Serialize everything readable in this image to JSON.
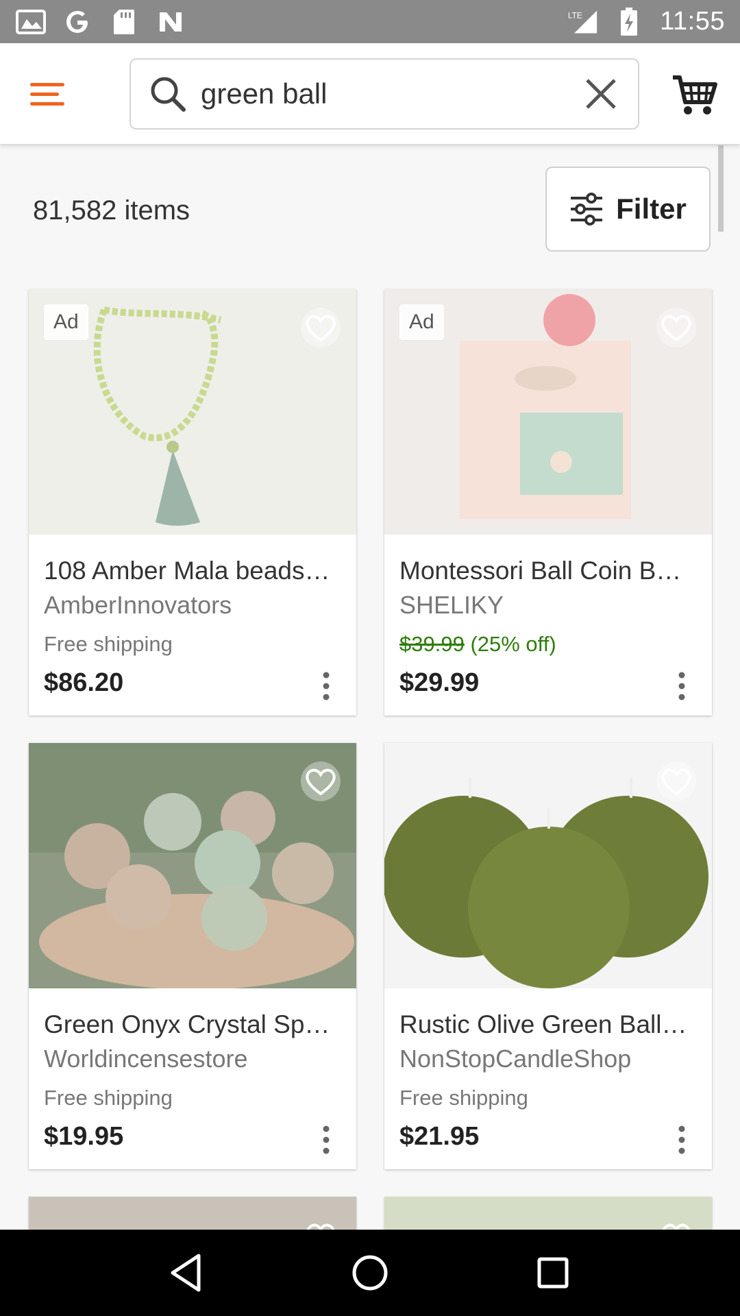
{
  "status_bar": {
    "time": "11:55",
    "network": "LTE",
    "left_icons": [
      "gallery-icon",
      "google-icon",
      "sd-card-icon",
      "n-icon"
    ]
  },
  "search": {
    "query": "green ball"
  },
  "results": {
    "count_text": "81,582 items",
    "filter_label": "Filter"
  },
  "listings": [
    {
      "ad_label": "Ad",
      "title": "108 Amber Mala beads…",
      "shop": "AmberInnovators",
      "shipping": "Free shipping",
      "price": "$86.20"
    },
    {
      "ad_label": "Ad",
      "title": "Montessori Ball Coin B…",
      "shop": "SHELIKY",
      "original_price": "$39.99",
      "discount": "(25% off)",
      "price": "$29.99"
    },
    {
      "title": "Green Onyx Crystal Sp…",
      "shop": "Worldincensestore",
      "shipping": "Free shipping",
      "price": "$19.95"
    },
    {
      "title": "Rustic Olive Green Ball…",
      "shop": "NonStopCandleShop",
      "shipping": "Free shipping",
      "price": "$21.95"
    }
  ],
  "colors": {
    "accent": "#f1641e",
    "discount": "#2e7d0a",
    "status_bar": "#8a8a8a"
  }
}
